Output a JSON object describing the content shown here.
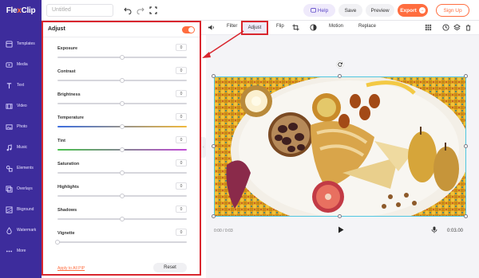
{
  "app": {
    "logo_text_a": "Fle",
    "logo_text_x": "x",
    "logo_text_b": "Clip",
    "project_title_placeholder": "Untitled"
  },
  "topbar": {
    "help": "Help",
    "save": "Save",
    "preview": "Preview",
    "export": "Export",
    "signup": "Sign Up"
  },
  "sidebar": {
    "items": [
      {
        "label": "Templates",
        "icon": "templates-icon"
      },
      {
        "label": "Media",
        "icon": "media-icon"
      },
      {
        "label": "Text",
        "icon": "text-icon"
      },
      {
        "label": "Video",
        "icon": "video-icon"
      },
      {
        "label": "Photo",
        "icon": "photo-icon"
      },
      {
        "label": "Music",
        "icon": "music-icon"
      },
      {
        "label": "Elements",
        "icon": "elements-icon"
      },
      {
        "label": "Overlays",
        "icon": "overlays-icon"
      },
      {
        "label": "Bkground",
        "icon": "background-icon"
      },
      {
        "label": "Watermark",
        "icon": "watermark-icon"
      },
      {
        "label": "More",
        "icon": "more-icon"
      }
    ]
  },
  "panel": {
    "title": "Adjust",
    "toggle_on": true,
    "rows": [
      {
        "label": "Exposure",
        "value": "0",
        "level": 0.5
      },
      {
        "label": "Contrast",
        "value": "0",
        "level": 0.5
      },
      {
        "label": "Brightness",
        "value": "0",
        "level": 0.5
      },
      {
        "label": "Temperature",
        "value": "0",
        "level": 0.5
      },
      {
        "label": "Tint",
        "value": "0",
        "level": 0.5
      },
      {
        "label": "Saturation",
        "value": "0",
        "level": 0.5
      },
      {
        "label": "Highlights",
        "value": "0",
        "level": 0.5
      },
      {
        "label": "Shadows",
        "value": "0",
        "level": 0.5
      },
      {
        "label": "Vignette",
        "value": "0",
        "level": 0.0
      }
    ],
    "apply_all": "Apply to All PIP",
    "reset": "Reset"
  },
  "toolbar": {
    "filter": "Filter",
    "adjust": "Adjust",
    "flip": "Flip",
    "motion": "Motion",
    "replace": "Replace"
  },
  "canvas": {
    "time": "0:00 / 0:03",
    "duration": "0:03.00"
  },
  "colors": {
    "brand": "#3d2c9c",
    "accent": "#ff6d3f",
    "highlight": "#d9262e"
  }
}
